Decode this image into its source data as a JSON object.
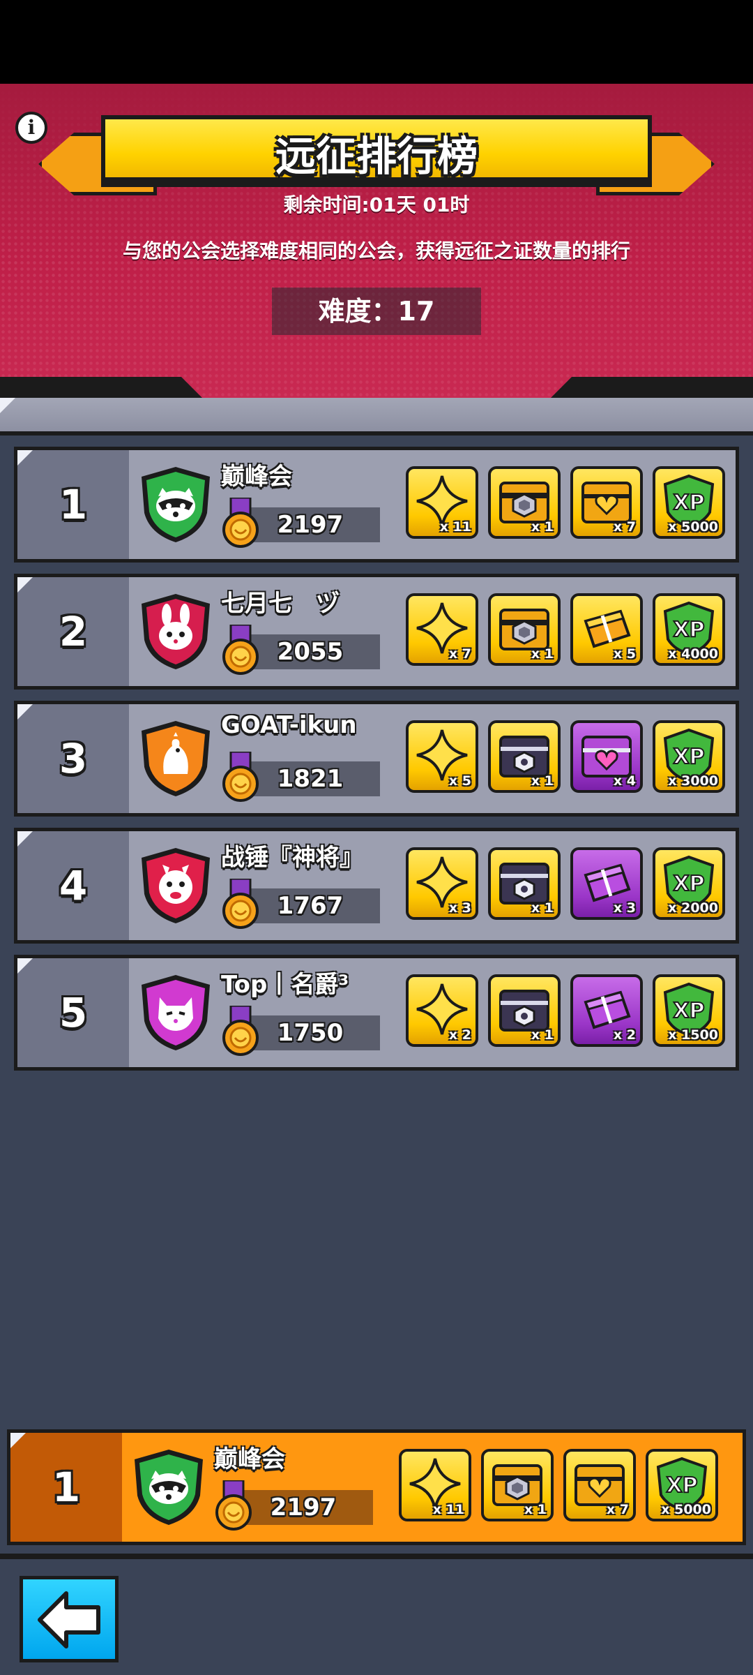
{
  "header": {
    "title": "远征排行榜",
    "remaining": "剩余时间:01天 01时",
    "description": "与您的公会选择难度相同的公会，获得远征之证数量的排行",
    "difficulty": "难度：17",
    "info_icon": "info-icon"
  },
  "rows": [
    {
      "rank": "1",
      "name": "巅峰会",
      "score": "2197",
      "shield_color": "#2fb34a",
      "emblem": "raccoon-icon",
      "rewards": [
        {
          "type": "star",
          "qty": "x 11"
        },
        {
          "type": "chest-gold-shield",
          "qty": "x 1"
        },
        {
          "type": "chest-gold-heart",
          "qty": "x 7"
        },
        {
          "type": "xp",
          "qty": "x 5000"
        }
      ]
    },
    {
      "rank": "2",
      "name": "七月七　ヅ",
      "score": "2055",
      "shield_color": "#d61e4e",
      "emblem": "rabbit-icon",
      "rewards": [
        {
          "type": "star",
          "qty": "x 7"
        },
        {
          "type": "chest-gold-shield",
          "qty": "x 1"
        },
        {
          "type": "gift-gold",
          "qty": "x 5"
        },
        {
          "type": "xp",
          "qty": "x 4000"
        }
      ]
    },
    {
      "rank": "3",
      "name": "GOAT-ikun",
      "score": "1821",
      "shield_color": "#f5861a",
      "emblem": "chicken-icon",
      "rewards": [
        {
          "type": "star",
          "qty": "x 5"
        },
        {
          "type": "chest-dark-shield",
          "qty": "x 1"
        },
        {
          "type": "chest-purple-heart",
          "qty": "x 4"
        },
        {
          "type": "xp",
          "qty": "x 3000"
        }
      ]
    },
    {
      "rank": "4",
      "name": "战锤『神将』",
      "score": "1767",
      "shield_color": "#e0204a",
      "emblem": "llama-icon",
      "rewards": [
        {
          "type": "star",
          "qty": "x 3"
        },
        {
          "type": "chest-dark-shield",
          "qty": "x 1"
        },
        {
          "type": "gift-purple",
          "qty": "x 3"
        },
        {
          "type": "xp",
          "qty": "x 2000"
        }
      ]
    },
    {
      "rank": "5",
      "name": "Top丨名爵³",
      "score": "1750",
      "shield_color": "#d13ad0",
      "emblem": "cat-icon",
      "rewards": [
        {
          "type": "star",
          "qty": "x 2"
        },
        {
          "type": "chest-dark-shield",
          "qty": "x 1"
        },
        {
          "type": "gift-purple",
          "qty": "x 2"
        },
        {
          "type": "xp",
          "qty": "x 1500"
        }
      ]
    }
  ],
  "my_guild": {
    "rank": "1",
    "name": "巅峰会",
    "score": "2197",
    "rewards": [
      {
        "type": "star",
        "qty": "x 11"
      },
      {
        "type": "chest-gold-shield",
        "qty": "x 1"
      },
      {
        "type": "chest-gold-heart",
        "qty": "x 7"
      },
      {
        "type": "xp",
        "qty": "x 5000"
      }
    ]
  },
  "back_button": {
    "icon": "back-arrow-icon"
  }
}
